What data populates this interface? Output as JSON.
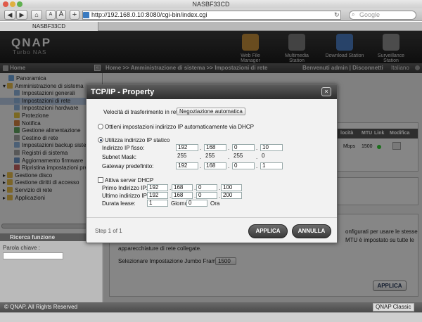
{
  "window": {
    "title": "NASBF33CD"
  },
  "browser": {
    "url": "http://192.168.0.10:8080/cgi-bin/index.cgi",
    "search_placeholder": "Google",
    "tab_title": "NASBF33CD",
    "btn_a_small": "A",
    "btn_a_large": "A",
    "btn_add": "+"
  },
  "app": {
    "logo": "QNAP",
    "logo_sub": "Turbo NAS",
    "apps": [
      {
        "label": "Web File Manager",
        "color": "#c08a3a"
      },
      {
        "label": "Multimedia Station",
        "color": "#7a7a7a"
      },
      {
        "label": "Download Station",
        "color": "#4a7ac0"
      },
      {
        "label": "Surveillance Station",
        "color": "#8a8a8a"
      }
    ]
  },
  "nav": {
    "home": "Home",
    "breadcrumb": "Home >> Amministrazione di sistema >> Impostazioni di rete",
    "user": "Benvenuti admin | Disconnetti",
    "lang": "Italiano"
  },
  "sidebar": {
    "items": [
      {
        "label": "Panoramica",
        "indent": 1,
        "color": "#6aa0d8"
      },
      {
        "label": "Amministrazione di sistema",
        "indent": 0,
        "color": "#e2b94a",
        "expanded": true
      },
      {
        "label": "Impostazioni generali",
        "indent": 2,
        "color": "#8ab0d8"
      },
      {
        "label": "Impostazioni di rete",
        "indent": 2,
        "color": "#8ab0d8",
        "selected": true
      },
      {
        "label": "Impostazioni hardware",
        "indent": 2,
        "color": "#8ab0d8"
      },
      {
        "label": "Protezione",
        "indent": 2,
        "color": "#e0c040"
      },
      {
        "label": "Notifica",
        "indent": 2,
        "color": "#d08040"
      },
      {
        "label": "Gestione alimentazione",
        "indent": 2,
        "color": "#60a060"
      },
      {
        "label": "Cestino di rete",
        "indent": 2,
        "color": "#a0a0a0"
      },
      {
        "label": "Impostazioni backup sistema",
        "indent": 2,
        "color": "#8ab0d8"
      },
      {
        "label": "Registri di sistema",
        "indent": 2,
        "color": "#a0a0a0"
      },
      {
        "label": "Aggiornamento firmware",
        "indent": 2,
        "color": "#6a90c0"
      },
      {
        "label": "Ripristina impostazioni predefinite",
        "indent": 2,
        "color": "#c06060"
      },
      {
        "label": "Gestione disco",
        "indent": 0,
        "color": "#e2b94a"
      },
      {
        "label": "Gestione diritti di accesso",
        "indent": 0,
        "color": "#e2b94a"
      },
      {
        "label": "Servizio di rete",
        "indent": 0,
        "color": "#e2b94a"
      },
      {
        "label": "Applicazioni",
        "indent": 0,
        "color": "#e2b94a"
      }
    ],
    "search_title": "Ricerca funzione",
    "search_label": "Parola chiave :"
  },
  "main": {
    "table_headers": [
      "locità",
      "MTU",
      "Link",
      "Modifica"
    ],
    "row": {
      "speed": "Mbps",
      "mtu": "1500"
    },
    "text1": "onfigurati per usare le stesse",
    "text2": "MTU è impostato su tutte le",
    "text3": "apparecchiature di rete collegate.",
    "jumbo_label": "Selezionare Impostazione Jumbo Frame:",
    "jumbo_value": "1500",
    "apply": "APPLICA"
  },
  "footer": {
    "copyright": "© QNAP, All Rights Reserved",
    "theme": "QNAP Classic"
  },
  "dialog": {
    "title": "TCP/IP - Property",
    "speed_label": "Velocità di trasferimento in rete",
    "speed_value": "Negoziazione automatica",
    "dhcp_label": "Ottieni impostazioni indirizzo IP automaticamente via DHCP",
    "static_label": "Utilizza indirizzo IP statico",
    "ip_label": "Indirizzo IP fisso:",
    "ip": [
      "192",
      "168",
      "0",
      "10"
    ],
    "mask_label": "Subnet Mask:",
    "mask": [
      "255",
      "255",
      "255",
      "0"
    ],
    "gw_label": "Gateway predefinito:",
    "gw": [
      "192",
      "168",
      "0",
      "1"
    ],
    "dhcpserver_label": "Attiva server DHCP",
    "first_label": "Primo Indirizzo IP:",
    "first": [
      "192",
      "168",
      "0",
      "100"
    ],
    "last_label": "Ultimo indirizzo IP:",
    "last": [
      "192",
      "168",
      "0",
      "200"
    ],
    "lease_label": "Durata lease:",
    "lease_days": "1",
    "days_label": "Giorno",
    "lease_hours": "0",
    "hours_label": "Ora",
    "step": "Step 1 of 1",
    "apply": "APPLICA",
    "cancel": "ANNULLA",
    "close": "×"
  }
}
